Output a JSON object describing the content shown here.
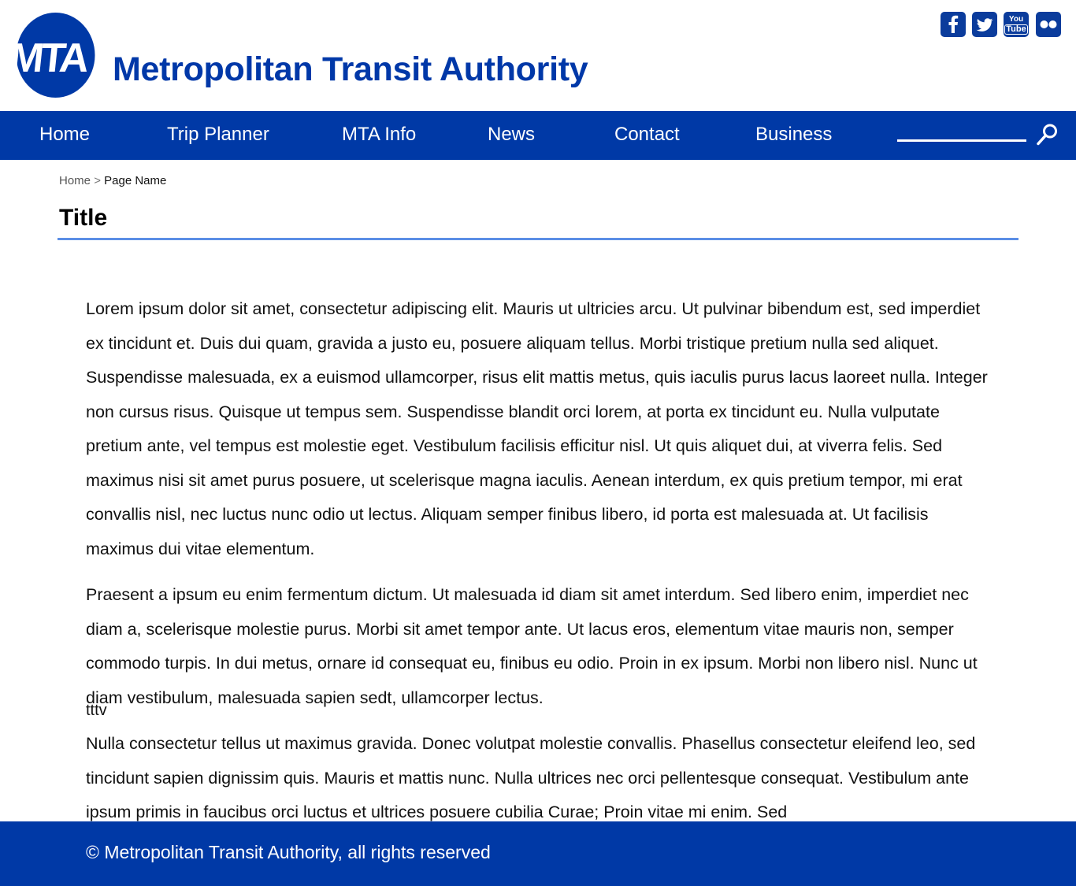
{
  "header": {
    "logo_text": "MTA",
    "site_title": "Metropolitan Transit Authority",
    "social": [
      {
        "icon": "facebook-icon",
        "glyph": "f"
      },
      {
        "icon": "twitter-icon",
        "glyph": "t"
      },
      {
        "icon": "youtube-icon",
        "glyph_top": "You",
        "glyph_bottom": "Tube"
      },
      {
        "icon": "flickr-icon",
        "glyph": "••"
      }
    ]
  },
  "nav": {
    "items": [
      "Home",
      "Trip Planner",
      "MTA Info",
      "News",
      "Contact",
      "Business"
    ],
    "search_placeholder": "",
    "search_icon": "search-icon"
  },
  "breadcrumb": {
    "home": "Home",
    "separator": ">",
    "current": "Page Name"
  },
  "page": {
    "title": "Title",
    "paragraphs": [
      "Lorem ipsum dolor sit amet, consectetur adipiscing elit. Mauris ut ultricies arcu. Ut pulvinar bibendum est, sed imperdiet ex tincidunt et. Duis dui quam, gravida a justo eu, posuere aliquam tellus. Morbi tristique pretium nulla sed aliquet. Suspendisse malesuada, ex a euismod ullamcorper, risus elit mattis metus, quis iaculis purus lacus laoreet nulla. Integer non cursus risus. Quisque ut tempus sem. Suspendisse blandit orci lorem, at porta ex tincidunt eu. Nulla vulputate pretium ante, vel tempus est molestie eget. Vestibulum facilisis efficitur nisl. Ut quis aliquet dui, at viverra felis. Sed maximus nisi sit amet purus posuere, ut scelerisque magna iaculis. Aenean interdum, ex quis pretium tempor, mi erat convallis nisl, nec luctus nunc odio ut lectus. Aliquam semper finibus libero, id porta est malesuada at. Ut facilisis maximus dui vitae elementum.",
      "Praesent a ipsum eu enim fermentum dictum. Ut malesuada id diam sit amet interdum. Sed libero enim, imperdiet nec diam a, scelerisque molestie purus. Morbi sit amet tempor ante. Ut lacus eros, elementum vitae mauris non, semper commodo turpis. In dui metus, ornare id consequat eu, finibus eu odio. Proin in ex ipsum. Morbi non libero nisl. Nunc ut diam vestibulum, malesuada sapien sedt, ullamcorper lectus.",
      "Nulla consectetur tellus ut maximus gravida. Donec volutpat molestie convallis. Phasellus consectetur eleifend leo, sed tincidunt sapien dignissim quis. Mauris et mattis nunc. Nulla ultrices nec orci pellentesque consequat. Vestibulum ante ipsum primis in faucibus orci luctus et ultrices posuere cubilia Curae; Proin vitae mi enim. Sed"
    ],
    "stray_text": "tttv"
  },
  "footer": {
    "copyright": "© Metropolitan Transit Authority, all rights reserved"
  },
  "colors": {
    "brand_blue": "#0039a6",
    "title_blue": "#0038a8",
    "rule_blue": "#5b8ee6"
  }
}
